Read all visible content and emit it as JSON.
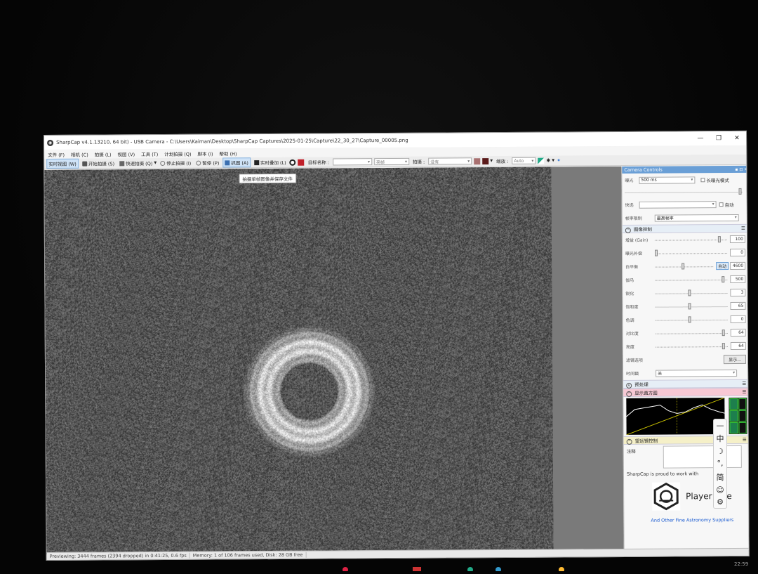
{
  "window": {
    "title": "SharpCap v4.1.13210, 64 bit) - USB Camera - C:\\Users\\Kaiman\\Desktop\\SharpCap Captures\\2025-01-25\\Capture\\22_30_27\\Capture_00005.png",
    "app_icon": "sharpcap-logo-icon"
  },
  "menu": [
    "文件 (F)",
    "相机 (C)",
    "拍摄 (L)",
    "视图 (V)",
    "工具 (T)",
    "计划拍摄 (Q)",
    "脚本 (I)",
    "帮助 (H)"
  ],
  "toolbar": {
    "live_view": "实时视图 (W)",
    "start_capture": "开始拍摄 (S)",
    "quick_capture": "快速拍摄 (Q)",
    "stop_capture": "停止拍摄 (I)",
    "pause": "暂停 (P)",
    "snapshot": "抓图 (A)",
    "live_stack": "实时叠加 (L)",
    "target_name_label": "目标名称 :",
    "target_name_value": "",
    "profile_combo": "亮帧",
    "capture_type_label": "拍摄 :",
    "capture_type_value": "没有",
    "zoom_label": "缩放 :",
    "zoom_value": "Auto"
  },
  "tooltip": "拍摄单帧图像并保存文件",
  "status": {
    "previewing": "Previewing: 3444 frames (2394 dropped) in 0:41:25, 0.6 fps",
    "memory": "Memory: 1 of 106 frames used, Disk: 28 GB free"
  },
  "panel": {
    "header": "Camera Controls",
    "exposure_label": "曝光",
    "exposure_value": "500 ms",
    "long_exposure_label": "长曝光模式",
    "fast_label": "快选",
    "auto_label": "自动",
    "frame_rate_label": "帧率限制",
    "frame_rate_value": "最高帧率",
    "image_controls": "图像控制",
    "controls": [
      {
        "label": "增益 (Gain)",
        "value": "100",
        "pos": 0.95
      },
      {
        "label": "曝光补偿",
        "value": "0",
        "pos": 0.0
      },
      {
        "label": "白平衡",
        "value": "4600",
        "pos": 0.5,
        "auto": "自动"
      },
      {
        "label": "伽马",
        "value": "500",
        "pos": 1.0
      },
      {
        "label": "锐化",
        "value": "3",
        "pos": 0.5
      },
      {
        "label": "饱和度",
        "value": "65",
        "pos": 0.5
      },
      {
        "label": "色调",
        "value": "0",
        "pos": 0.5
      },
      {
        "label": "对比度",
        "value": "64",
        "pos": 1.0
      },
      {
        "label": "亮度",
        "value": "64",
        "pos": 1.0
      }
    ],
    "filter_label": "滤镜选项",
    "filter_button": "显示...",
    "timestamp_label": "时间戳",
    "timestamp_value": "关",
    "preprocess": "预处理",
    "histogram": "显示直方图",
    "telescope": "望远镜控制",
    "notes_label": "注释",
    "sponsor_text": "SharpCap is proud to work with",
    "sponsor_name": "Player One",
    "sponsor_link": "And Other Fine Astronomy Suppliers"
  },
  "ime": [
    "—",
    "中",
    "☽",
    "°,",
    "简",
    "☺",
    "⚙"
  ],
  "clock": "22:59"
}
